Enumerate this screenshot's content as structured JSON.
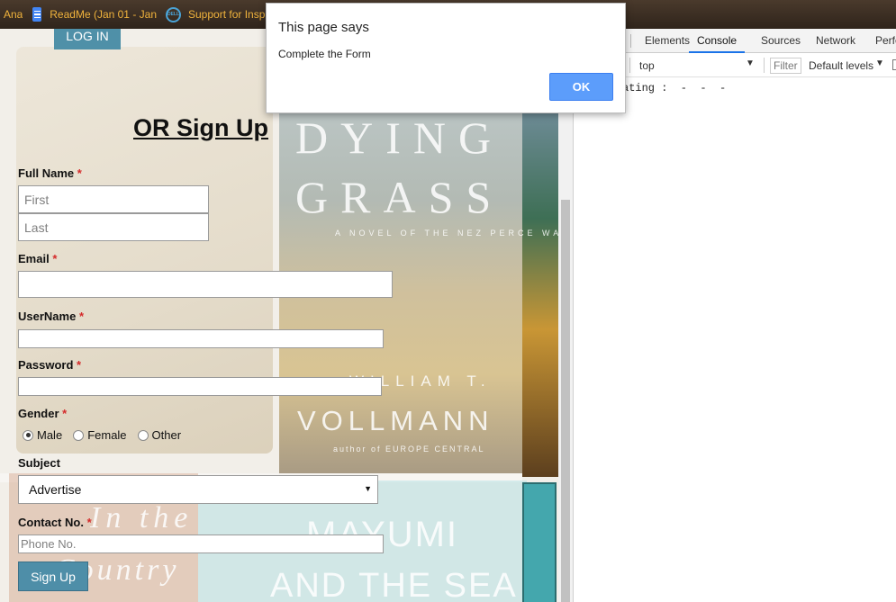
{
  "bookmarks": {
    "items": [
      {
        "label": "Ana",
        "icon": "none"
      },
      {
        "label": "ReadMe (Jan 01 - Jan",
        "icon": "document-icon"
      },
      {
        "label": "Support for Insp",
        "icon": "dell-logo-icon"
      }
    ]
  },
  "page": {
    "login_label": "LOG IN",
    "form_title": "OR Sign Up",
    "fields": {
      "full_name_label": "Full Name",
      "first_placeholder": "First",
      "last_placeholder": "Last",
      "email_label": "Email",
      "username_label": "UserName",
      "password_label": "Password",
      "gender_label": "Gender",
      "gender_options": [
        "Male",
        "Female",
        "Other"
      ],
      "gender_selected": "Male",
      "subject_label": "Subject",
      "subject_value": "Advertise",
      "contact_label": "Contact No.",
      "phone_placeholder": "Phone No.",
      "required_marker": "*"
    },
    "signup_label": "Sign Up",
    "background_book_text": {
      "title_line1": "DYING",
      "title_line2": "GRASS",
      "subtitle": "A NOVEL OF THE NEZ PERCE WAR",
      "author_first": "WILLIAM T.",
      "author_last": "VOLLMANN",
      "author_note": "author of EUROPE CENTRAL",
      "book2_line1": "MAYUMI",
      "book2_line2": "AND THE SEA",
      "book3_line1": "In the",
      "book3_line2": "Country"
    }
  },
  "alert": {
    "title": "This page says",
    "message": "Complete the Form",
    "ok_label": "OK"
  },
  "devtools": {
    "tabs": [
      "Elements",
      "Console",
      "Sources",
      "Network",
      "Perfo"
    ],
    "active_tab": "Console",
    "context": "top",
    "filter_placeholder": "Filter",
    "levels": "Default levels",
    "console_line": "ating :  -  -  -"
  },
  "colors": {
    "accent": "#4e8ea8",
    "required": "#d42a2a",
    "alert_ok": "#5c9dfb",
    "bookmark_text": "#f0b33c"
  }
}
